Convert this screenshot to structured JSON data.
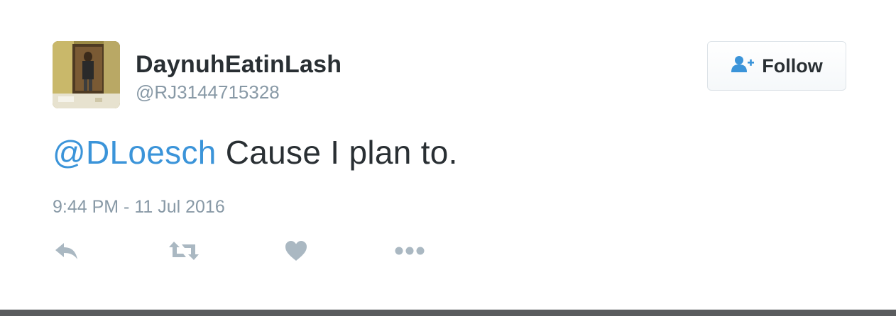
{
  "tweet": {
    "author": {
      "display_name": "DaynuhEatinLash",
      "screen_name": "@RJ3144715328"
    },
    "follow_button": {
      "label": "Follow",
      "icon": "add-user-icon"
    },
    "mention": "@DLoesch",
    "body": " Cause I plan to.",
    "timestamp": "9:44 PM - 11 Jul 2016"
  },
  "actions": [
    {
      "name": "reply",
      "icon": "reply-icon"
    },
    {
      "name": "retweet",
      "icon": "retweet-icon"
    },
    {
      "name": "like",
      "icon": "heart-icon"
    },
    {
      "name": "more",
      "icon": "more-icon"
    }
  ],
  "colors": {
    "link": "#3b94d9",
    "text": "#292f33",
    "muted": "#8899a6",
    "icon": "#aab8c2"
  }
}
